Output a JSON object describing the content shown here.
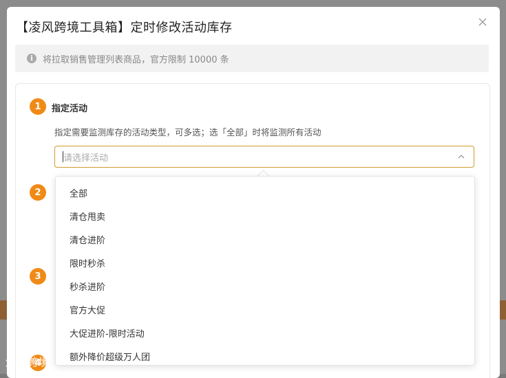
{
  "modal": {
    "title": "【凌风跨境工具箱】定时修改活动库存",
    "notice": "将拉取销售管理列表商品，官方限制 10000 条"
  },
  "steps": [
    {
      "number": "1",
      "title": "指定活动",
      "description": "指定需要监测库存的活动类型，可多选；选「全部」时将监测所有活动"
    },
    {
      "number": "2"
    },
    {
      "number": "3"
    },
    {
      "number": "4"
    }
  ],
  "activity_select": {
    "placeholder": "请选择活动",
    "options": [
      "全部",
      "清仓甩卖",
      "清仓进阶",
      "限时秒杀",
      "秒杀进阶",
      "官方大促",
      "大促进阶-限时活动",
      "额外降价超级万人团"
    ]
  },
  "watermark": "大卖跨境",
  "colors": {
    "accent": "#f08a17",
    "select_border": "#d39a2a"
  }
}
